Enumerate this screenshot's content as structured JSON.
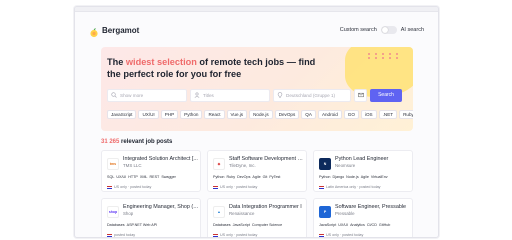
{
  "brand": {
    "name": "Bergamot"
  },
  "header": {
    "custom_search_label": "Custom search",
    "ai_search_label": "AI search"
  },
  "hero": {
    "title_prefix": "The ",
    "title_accent": "widest selection",
    "title_suffix": " of remote tech jobs — find the perfect role for you for free"
  },
  "search": {
    "keywords_placeholder": "Show more",
    "title_placeholder": "Titles",
    "location_placeholder": "Deutschland (Gruppe 1)",
    "button_label": "Search"
  },
  "tags": [
    "JavaScript",
    "UX/UI",
    "PHP",
    "Python",
    "React",
    "Vue.js",
    "Node.js",
    "DevOps",
    "QA",
    "Android",
    "GO",
    "iOS",
    ".NET",
    "Ruby",
    "AWS",
    "JAVA"
  ],
  "results": {
    "count": "31 265",
    "label": " relevant job posts"
  },
  "jobs": [
    {
      "title": "Integrated Solution Architect [...",
      "company": "TMS LLC",
      "logo_text": "tms",
      "logo_bg": "#ffffff",
      "logo_fg": "#e2731a",
      "tags": [
        "SQL",
        "UX/UI",
        "HTTP",
        "XML",
        "REST",
        "Swagger"
      ],
      "meta": "US only · posted today"
    },
    {
      "title": "Staff Software Development E...",
      "company": "TileDyne, Inc.",
      "logo_text": "◆",
      "logo_bg": "#ffffff",
      "logo_fg": "#d94040",
      "tags": [
        "Python",
        "Ruby",
        "DevOps",
        "Agile",
        "Git",
        "PyTest"
      ],
      "meta": "US only · posted today"
    },
    {
      "title": "Python Lead Engineer",
      "company": "Neomsure",
      "logo_text": "N",
      "logo_bg": "#0d2a5c",
      "logo_fg": "#ffffff",
      "tags": [
        "Python",
        "Django",
        "Node.js",
        "Agile",
        "VirtualEnv"
      ],
      "meta": "Latin America only · posted today"
    },
    {
      "title": "Engineering Manager, Shop (R...",
      "company": "Shop",
      "logo_text": "shop",
      "logo_bg": "#ffffff",
      "logo_fg": "#5a31f4",
      "tags": [
        "Databases",
        "ASP.NET Web API"
      ],
      "meta": "posted today"
    },
    {
      "title": "Data Integration Programmer I",
      "company": "Renaissance",
      "logo_text": "▲",
      "logo_bg": "#ffffff",
      "logo_fg": "#1a7bd4",
      "tags": [
        "Databases",
        "JavaScript",
        "Computer Science"
      ],
      "meta": "US only · posted today"
    },
    {
      "title": "Software Engineer, Pressable",
      "company": "Pressable",
      "logo_text": "P",
      "logo_bg": "#1e66d6",
      "logo_fg": "#ffffff",
      "tags": [
        "JavaScript",
        "UX/UI",
        "Analytics",
        "CI/CD",
        "GitHub"
      ],
      "meta": "US only · posted today"
    }
  ]
}
